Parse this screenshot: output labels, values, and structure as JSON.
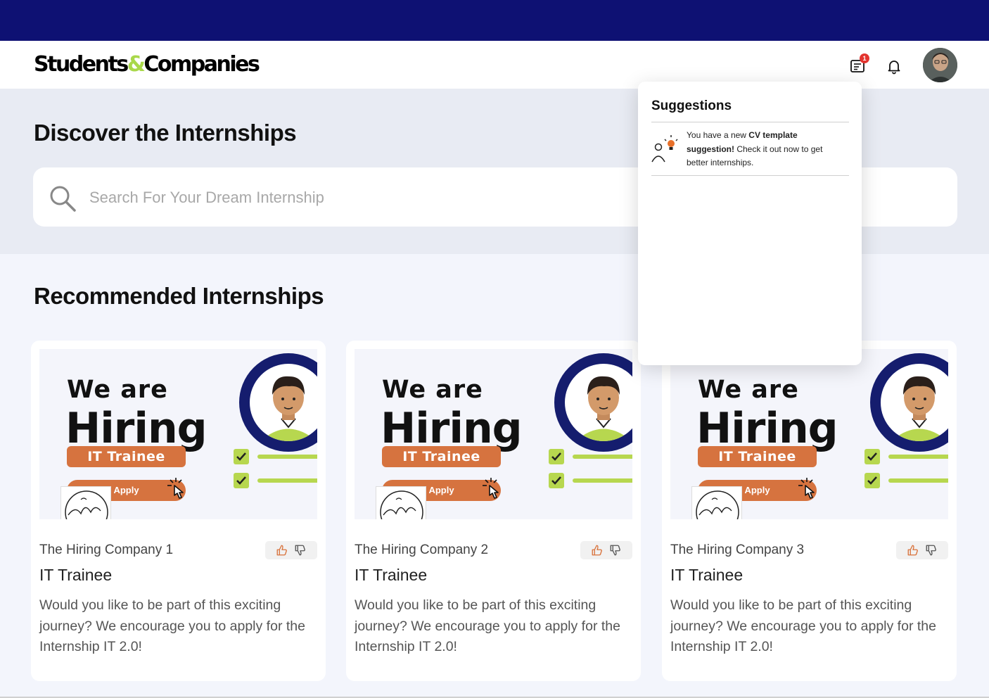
{
  "app": {
    "brand_part1": "Students",
    "brand_amp": "&",
    "brand_part2": "Companies"
  },
  "header": {
    "notification_badge_count": "1",
    "icons": [
      "cv-document-icon",
      "bell-icon"
    ],
    "avatar": "user-avatar"
  },
  "hero": {
    "title": "Discover the Internships",
    "search_placeholder": "Search For Your Dream Internship"
  },
  "recommended": {
    "title": "Recommended Internships",
    "cards": [
      {
        "company": "The Hiring Company 1",
        "title": "IT Trainee",
        "description": "Would you like to be part of this exciting journey? We encourage you to apply for the Internship IT 2.0!",
        "banner": {
          "line1": "We are",
          "line2": "Hiring",
          "role": "IT Trainee",
          "apply": "Apply"
        }
      },
      {
        "company": "The Hiring Company 2",
        "title": "IT Trainee",
        "description": "Would you like to be part of this exciting journey? We encourage you to apply for the Internship IT 2.0!",
        "banner": {
          "line1": "We are",
          "line2": "Hiring",
          "role": "IT Trainee",
          "apply": "Apply"
        }
      },
      {
        "company": "The Hiring Company 3",
        "title": "IT Trainee",
        "description": "Would you like to be part of this exciting journey? We encourage you to apply for the Internship IT 2.0!",
        "banner": {
          "line1": "We are",
          "line2": "Hiring",
          "role": "IT Trainee",
          "apply": "Apply"
        }
      }
    ]
  },
  "suggestions": {
    "title": "Suggestions",
    "item": {
      "text_pre": "You have a new ",
      "text_bold": "CV template suggestion!",
      "text_post": " Check it out now to get better internships."
    }
  },
  "colors": {
    "topbar": "#0e1173",
    "brand_accent": "#a9d84a",
    "banner_orange": "#d6733f",
    "badge_red": "#e3342f"
  }
}
